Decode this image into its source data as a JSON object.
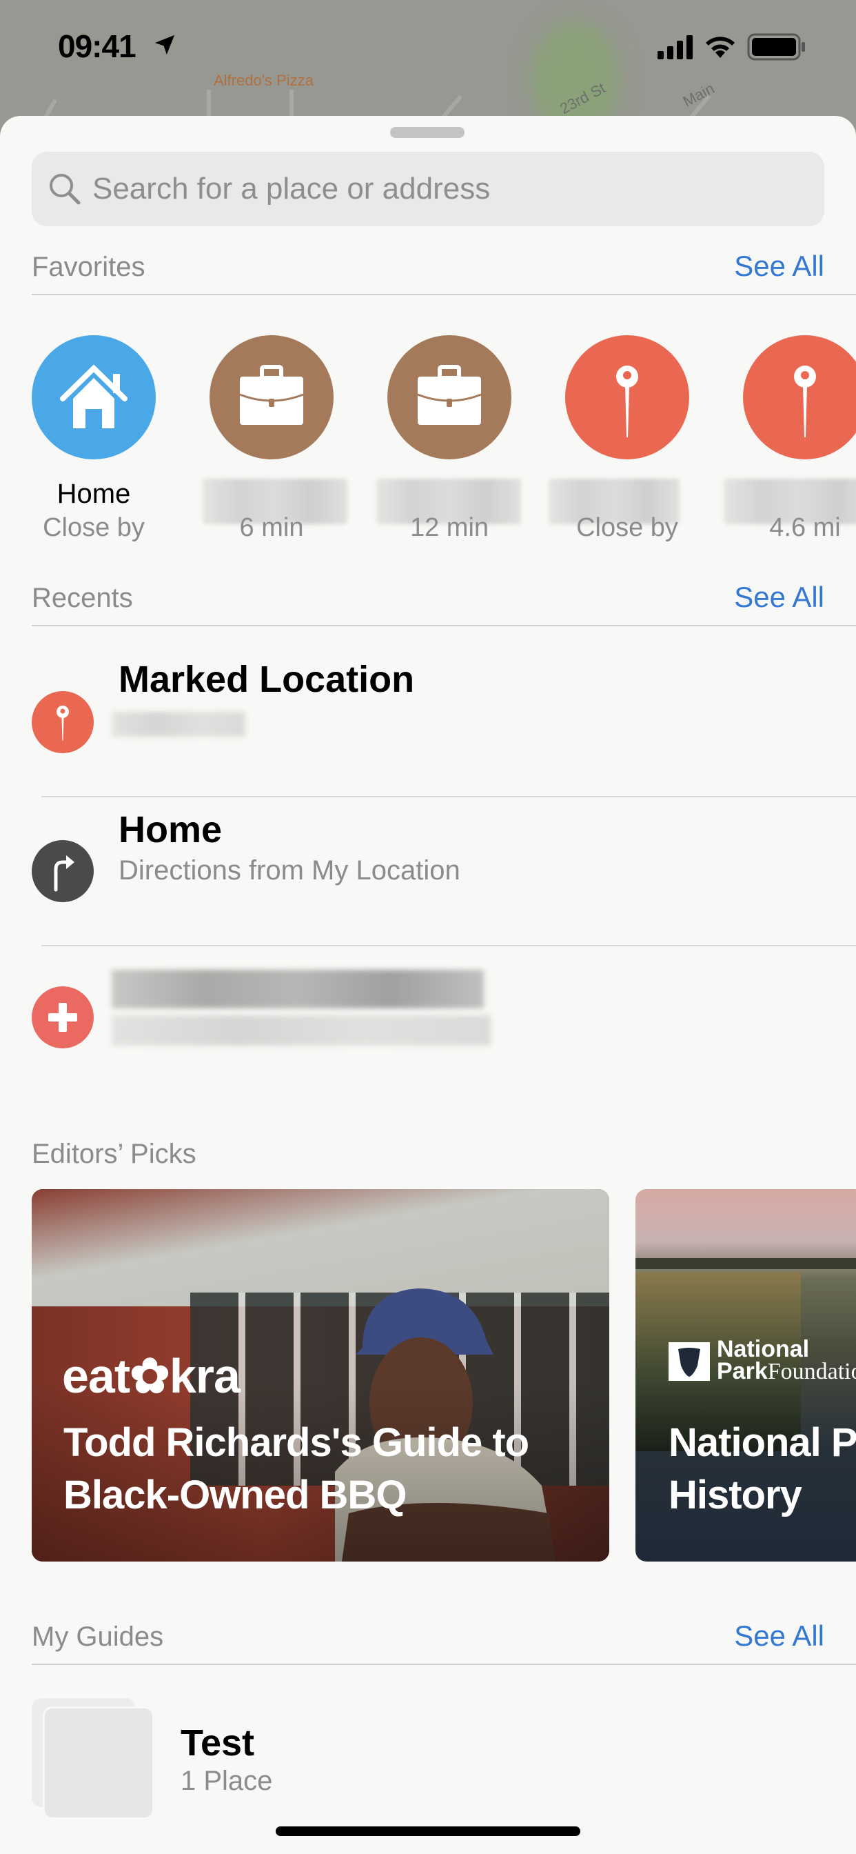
{
  "status_bar": {
    "time": "09:41",
    "location_icon": "location-arrow-icon",
    "signal_icon": "cellular-signal-icon",
    "wifi_icon": "wifi-icon",
    "battery_icon": "battery-icon"
  },
  "map": {
    "street_labels": [
      "Alfredo's Pizza",
      "23rd St",
      "Main"
    ]
  },
  "search": {
    "placeholder": "Search for a place or address",
    "value": ""
  },
  "favorites": {
    "title": "Favorites",
    "see_all": "See All",
    "items": [
      {
        "name": "Home",
        "detail": "Close by",
        "icon": "home-icon",
        "color": "#4aa8e6",
        "name_redacted": false
      },
      {
        "name": "",
        "detail": "6 min",
        "icon": "briefcase-icon",
        "color": "#a57a5a",
        "name_redacted": true
      },
      {
        "name": "",
        "detail": "12 min",
        "icon": "briefcase-icon",
        "color": "#a57a5a",
        "name_redacted": true
      },
      {
        "name": "",
        "detail": "Close by",
        "icon": "pin-icon",
        "color": "#ea6752",
        "name_redacted": true
      },
      {
        "name": "",
        "detail": "4.6 mi",
        "icon": "pin-icon",
        "color": "#ea6752",
        "name_redacted": true
      }
    ]
  },
  "recents": {
    "title": "Recents",
    "see_all": "See All",
    "items": [
      {
        "title": "Marked Location",
        "subtitle": "",
        "icon": "pin-icon",
        "color": "#ea6752",
        "subtitle_redacted": true
      },
      {
        "title": "Home",
        "subtitle": "Directions from My Location",
        "icon": "turn-right-arrow-icon",
        "color": "#4a4a4a",
        "subtitle_redacted": false
      },
      {
        "title": "",
        "subtitle": "",
        "icon": "medical-cross-icon",
        "color": "#ea6a62",
        "title_redacted": true,
        "subtitle_redacted": true
      }
    ]
  },
  "editors_picks": {
    "title": "Editors’ Picks",
    "cards": [
      {
        "brand": "eat✿kra",
        "title": "Todd Richards's Guide to Black-Owned BBQ"
      },
      {
        "brand_bold": "National",
        "brand_line2_bold": "Park",
        "brand_line2_thin": "Foundation",
        "title": "National Parks and Black History"
      }
    ]
  },
  "my_guides": {
    "title": "My Guides",
    "see_all": "See All",
    "items": [
      {
        "title": "Test",
        "subtitle": "1 Place"
      }
    ]
  },
  "colors": {
    "accent": "#3478d0",
    "secondary_text": "#8b8b8d",
    "sheet_bg": "#f8f8f6"
  }
}
